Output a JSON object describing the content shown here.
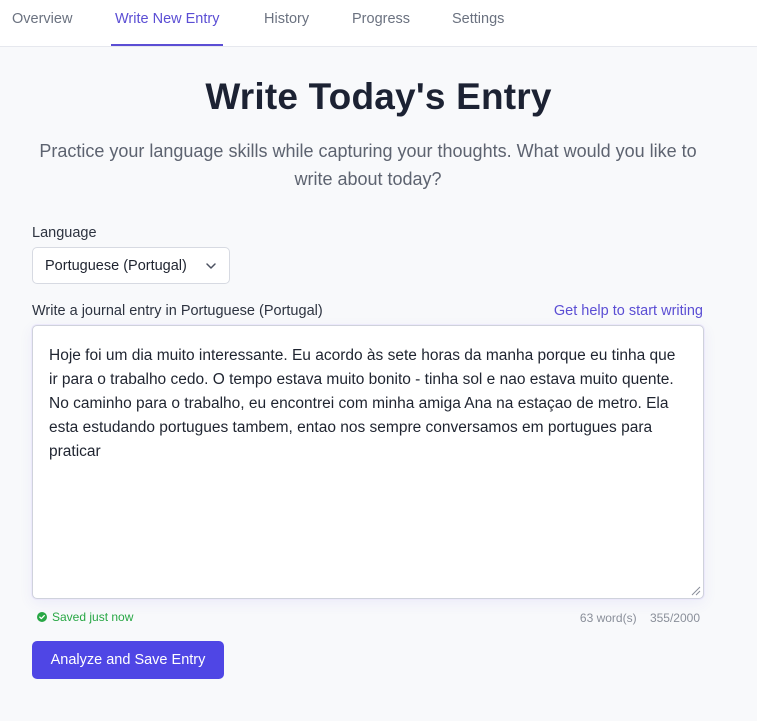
{
  "nav": {
    "tabs": [
      {
        "label": "Overview"
      },
      {
        "label": "Write New Entry",
        "active": true
      },
      {
        "label": "History"
      },
      {
        "label": "Progress"
      },
      {
        "label": "Settings"
      }
    ]
  },
  "main": {
    "title": "Write Today's Entry",
    "subtitle": "Practice your language skills while capturing your thoughts. What would you like to write about today?",
    "language_label": "Language",
    "language_value": "Portuguese (Portugal)",
    "entry_label": "Write a journal entry in Portuguese (Portugal)",
    "help_link": "Get help to start writing",
    "entry_text": "Hoje foi um dia muito interessante. Eu acordo às sete horas da manha porque eu tinha que ir para o trabalho cedo. O tempo estava muito bonito - tinha sol e nao estava muito quente. No caminho para o trabalho, eu encontrei com minha amiga Ana na estaçao de metro. Ela esta estudando portugues tambem, entao nos sempre conversamos em portugues para praticar",
    "saved_status": "Saved just now",
    "word_count": "63 word(s)",
    "char_count": "355/2000",
    "submit_label": "Analyze and Save Entry"
  },
  "colors": {
    "accent": "#5b4ed4",
    "button": "#4f46e5",
    "success": "#28a745"
  },
  "icons": {
    "select": "chevron-down-icon",
    "saved": "check-circle-icon",
    "resize": "resize-handle-icon"
  }
}
